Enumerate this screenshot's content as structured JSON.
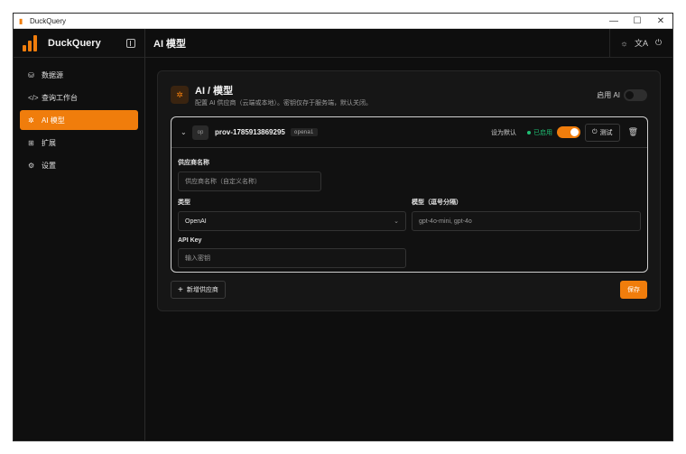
{
  "window": {
    "title": "DuckQuery",
    "controls": [
      "—",
      "☐",
      "✕"
    ]
  },
  "brand": {
    "name": "DuckQuery",
    "color": "#f07d0c"
  },
  "sidebar": {
    "items": [
      {
        "label": "数据源",
        "icon": "database-icon",
        "glyph": "⛁"
      },
      {
        "label": "查询工作台",
        "icon": "code-icon",
        "glyph": "</>"
      },
      {
        "label": "AI 模型",
        "icon": "sparkle-icon",
        "glyph": "✲",
        "active": true
      },
      {
        "label": "扩展",
        "icon": "puzzle-icon",
        "glyph": "⊞"
      },
      {
        "label": "设置",
        "icon": "gear-icon",
        "glyph": "⚙"
      }
    ]
  },
  "header": {
    "title": "AI 模型",
    "tools": [
      {
        "icon": "sun-icon",
        "glyph": "☼"
      },
      {
        "icon": "translate-icon",
        "glyph": "文A"
      },
      {
        "icon": "plug-icon",
        "glyph": "⏻"
      }
    ]
  },
  "card": {
    "title": "AI / 模型",
    "description": "配置 AI 供应商（云端或本地）。密钥仅存于服务端，默认关闭。",
    "ai_toggle_label": "启用 AI",
    "ai_enabled": false,
    "provider": {
      "avatar": "op",
      "id": "prov-1785913869295",
      "type_tag": "openai",
      "set_default_label": "设为默认",
      "enabled_label": "已启用",
      "enabled": true,
      "test_label": "测试",
      "name_label": "供应商名称",
      "name_placeholder": "供应商名称（自定义名称）",
      "type_label": "类型",
      "type_value": "OpenAI",
      "models_label": "模型（逗号分隔）",
      "models_value": "gpt-4o-mini, gpt-4o",
      "apikey_label": "API Key",
      "apikey_placeholder": "输入密钥"
    },
    "add_label": "新增供应商",
    "save_label": "保存"
  },
  "colors": {
    "accent": "#f07d0c",
    "success": "#1fbf74",
    "background": "#0e0e0e"
  }
}
